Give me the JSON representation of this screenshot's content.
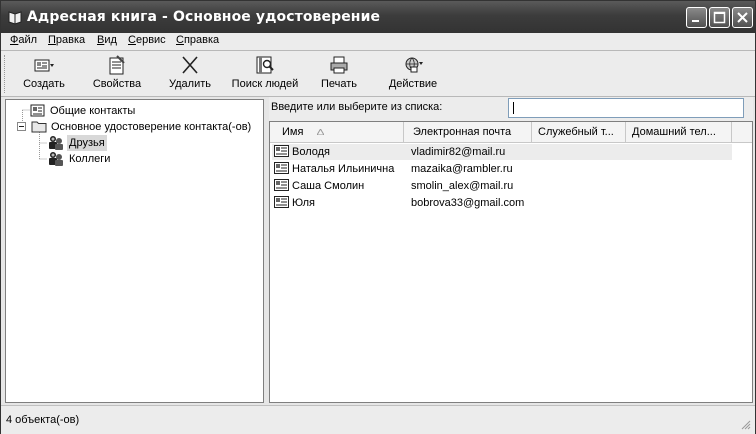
{
  "window": {
    "title": "Адресная книга - Основное удостоверение",
    "icon": "address-book-icon"
  },
  "menu": [
    {
      "label": "Файл",
      "underline": "Ф",
      "rest": "айл"
    },
    {
      "label": "Правка",
      "underline": "П",
      "rest": "равка"
    },
    {
      "label": "Вид",
      "underline": "В",
      "rest": "ид"
    },
    {
      "label": "Сервис",
      "underline": "С",
      "rest": "ервис"
    },
    {
      "label": "Справка",
      "underline": "С",
      "rest": "правка"
    }
  ],
  "toolbar": {
    "create": "Создать",
    "properties": "Свойства",
    "delete": "Удалить",
    "find": "Поиск людей",
    "print": "Печать",
    "action": "Действие"
  },
  "tree": {
    "shared": "Общие контакты",
    "main": "Основное удостоверение контакта(-ов)",
    "friends": "Друзья",
    "colleagues": "Коллеги"
  },
  "search": {
    "prompt": "Введите или выберите из списка:",
    "value": ""
  },
  "columns": {
    "name": "Имя",
    "email": "Электронная почта",
    "work_phone": "Служебный т...",
    "home_phone": "Домашний тел..."
  },
  "contacts": [
    {
      "name": "Володя",
      "email": "vladimir82@mail.ru"
    },
    {
      "name": "Наталья Ильинична",
      "email": "mazaika@rambler.ru"
    },
    {
      "name": "Саша Смолин",
      "email": "smolin_alex@mail.ru"
    },
    {
      "name": "Юля",
      "email": "bobrova33@gmail.com"
    }
  ],
  "status": {
    "text": "4 объекта(-ов)"
  }
}
